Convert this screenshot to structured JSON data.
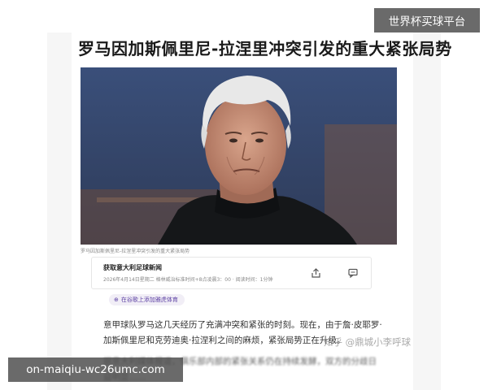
{
  "overlay": {
    "top_badge": "世界杯买球平台",
    "bottom_badge": "on-maiqiu-wc26umc.com",
    "watermark": "知乎 @鼎城小李呼球"
  },
  "article": {
    "title": "罗马因加斯佩里尼-拉涅里冲突引发的重大紧张局势",
    "photo_caption": "罗马因加斯佩里尼-拉涅里冲突引发的重大紧张局势",
    "source": {
      "name": "获取意大利足球新闻",
      "meta": "2026年4月14日星期二 格林威治标准时间+8点凌晨3：00 · 阅读时间：1分钟"
    },
    "follow_label": "在谷歌上添加雅虎体育",
    "paragraph_1": "意甲球队罗马这几天经历了充满冲突和紧张的时刻。现在，由于詹·皮耶罗·加斯佩里尼和克劳迪奥·拉涅利之间的麻烦，紧张局势正在升级。",
    "paragraph_2": "据意大利媒体报道，俱乐部内部的紧张关系仍在持续发酵，双方的分歧日益明显……"
  },
  "icons": {
    "share": "share-icon",
    "comment": "comment-icon",
    "plus": "plus-circle-icon"
  },
  "colors": {
    "badge_bg": "#505050",
    "follow_text": "#5b3fa3",
    "title": "#1a1a1a"
  }
}
